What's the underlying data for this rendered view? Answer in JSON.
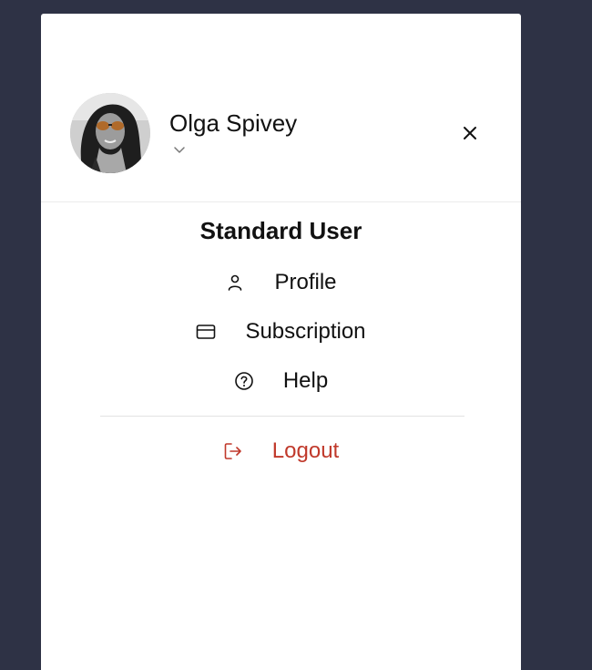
{
  "user": {
    "name": "Olga Spivey",
    "role": "Standard User"
  },
  "menu": {
    "items": [
      {
        "label": "Profile",
        "icon": "person-icon"
      },
      {
        "label": "Subscription",
        "icon": "credit-card-icon"
      },
      {
        "label": "Help",
        "icon": "help-circle-icon"
      }
    ],
    "logout": {
      "label": "Logout",
      "icon": "logout-icon"
    }
  },
  "colors": {
    "background": "#2e3245",
    "panel": "#ffffff",
    "logout": "#c0392b",
    "text": "#111111"
  }
}
